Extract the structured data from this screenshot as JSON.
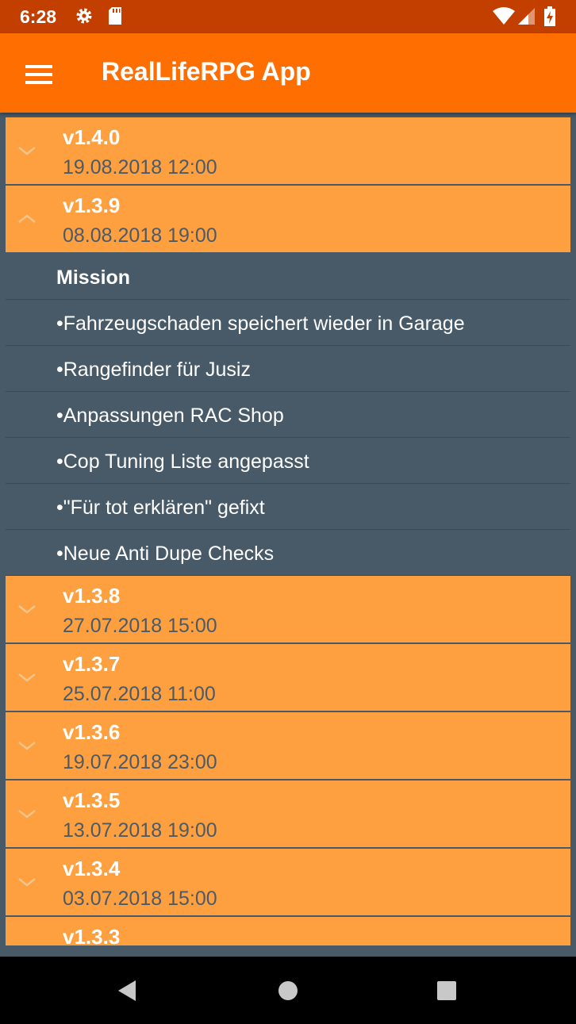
{
  "status_bar": {
    "time": "6:28",
    "icons": [
      "settings-gear-icon",
      "sd-card-icon",
      "wifi-icon",
      "cell-signal-icon",
      "battery-charging-icon"
    ]
  },
  "app_bar": {
    "title": "RealLifeRPG App",
    "menu_icon": "hamburger-menu-icon"
  },
  "changelog": {
    "groups": [
      {
        "version": "v1.4.0",
        "date": "19.08.2018 12:00",
        "expanded": false
      },
      {
        "version": "v1.3.9",
        "date": "08.08.2018 19:00",
        "expanded": true,
        "items": [
          "Mission",
          "•Fahrzeugschaden speichert wieder in Garage",
          "•Rangefinder für Jusiz",
          "•Anpassungen RAC Shop",
          "•Cop Tuning Liste angepasst",
          "•\"Für tot erklären\" gefixt",
          "•Neue Anti Dupe Checks"
        ]
      },
      {
        "version": "v1.3.8",
        "date": "27.07.2018 15:00",
        "expanded": false
      },
      {
        "version": "v1.3.7",
        "date": "25.07.2018 11:00",
        "expanded": false
      },
      {
        "version": "v1.3.6",
        "date": "19.07.2018 23:00",
        "expanded": false
      },
      {
        "version": "v1.3.5",
        "date": "13.07.2018 19:00",
        "expanded": false
      },
      {
        "version": "v1.3.4",
        "date": "03.07.2018 15:00",
        "expanded": false
      },
      {
        "version": "v1.3.3",
        "date": "",
        "expanded": false
      }
    ]
  },
  "nav_bar": {
    "buttons": [
      "back-icon",
      "home-icon",
      "recents-icon"
    ]
  },
  "colors": {
    "status_bar": "#c23f00",
    "app_bar": "#ff6e00",
    "group_header": "#ffa040",
    "list_background": "#485a68",
    "date_text": "#4c5a66"
  }
}
